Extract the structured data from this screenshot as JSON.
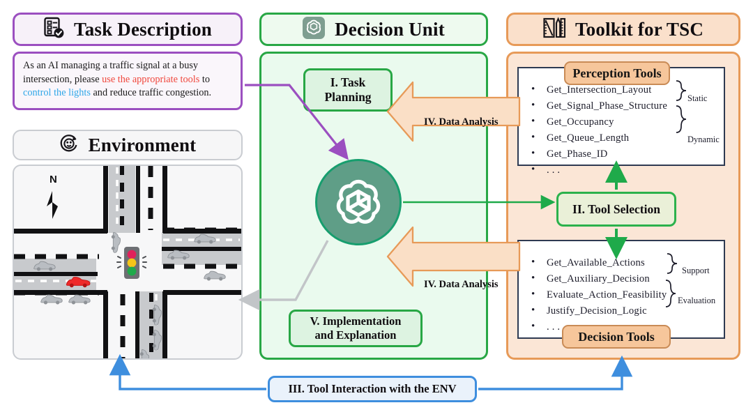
{
  "panels": {
    "task_description": {
      "title": "Task Description",
      "icon": "clipboard-check-icon",
      "accent": "#9b4fc0",
      "body": {
        "seg1": "As an AI managing a traffic signal at a busy intersection, please ",
        "seg2_red": "use the appropriate tools",
        "seg3": " to ",
        "seg4_blue": "control the lights",
        "seg5": " and reduce traffic congestion."
      }
    },
    "environment": {
      "title": "Environment",
      "icon": "globe-refresh-icon",
      "accent": "#c9ccd1",
      "compass": "N",
      "traffic_light": {
        "red": "#e0215b",
        "yellow": "#f5c518",
        "green": "#1faa4a"
      },
      "highlight_car_color": "#ef2a2a",
      "car_color": "#b9bdc2"
    },
    "decision_unit": {
      "title": "Decision Unit",
      "icon": "openai-logo-icon",
      "accent": "#28a745",
      "task_planning": "I. Task\nPlanning",
      "task_planning_line1": "I. Task",
      "task_planning_line2": "Planning",
      "implementation_line1": "V. Implementation",
      "implementation_line2": "and Explanation",
      "center_icon": "openai-logo-icon"
    },
    "toolkit": {
      "title": "Toolkit for TSC",
      "icon": "ruler-pencil-icon",
      "accent": "#e79a58",
      "perception": {
        "tag": "Perception Tools",
        "items": [
          "Get_Intersection_Layout",
          "Get_Signal_Phase_Structure",
          "Get_Occupancy",
          "Get_Queue_Length",
          "Get_Phase_ID",
          ". . ."
        ],
        "group_static": "Static",
        "group_dynamic": "Dynamic"
      },
      "decision": {
        "tag": "Decision Tools",
        "items": [
          "Get_Available_Actions",
          "Get_Auxiliary_Decision",
          "Evaluate_Action_Feasibility",
          "Justify_Decision_Logic",
          ". . ."
        ],
        "group_support": "Support",
        "group_evaluation": "Evaluation"
      },
      "tool_selection": "II. Tool Selection"
    }
  },
  "flow": {
    "data_analysis_top": "IV. Data Analysis",
    "data_analysis_bottom": "IV. Data Analysis",
    "tool_interaction": "III. Tool Interaction with the ENV"
  },
  "colors": {
    "purple": "#9b4fc0",
    "green": "#28a745",
    "orange": "#e79a58",
    "blue": "#3e8ede",
    "gray": "#c2c5c8",
    "red_text": "#f0473c",
    "blue_text": "#2fa7e8"
  }
}
